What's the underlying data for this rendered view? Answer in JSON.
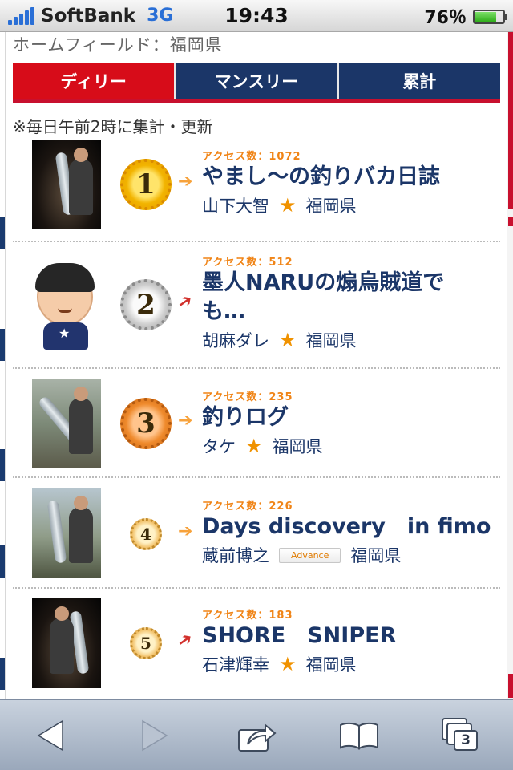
{
  "status_bar": {
    "carrier": "SoftBank",
    "network": "3G",
    "time": "19:43",
    "battery_text": "76％",
    "battery_level": 0.76
  },
  "page": {
    "home_field": "ホームフィールド：福岡県",
    "tabs": [
      {
        "label": "ディリー",
        "active": true
      },
      {
        "label": "マンスリー",
        "active": false
      },
      {
        "label": "累計",
        "active": false
      }
    ],
    "note": "※毎日午前2時に集計・更新"
  },
  "ranking": [
    {
      "rank": "1",
      "access": "アクセス数：1072",
      "title": "やまし〜の釣りバカ日誌",
      "owner": "山下大智",
      "mark": "★",
      "region": "福岡県",
      "trend": "right",
      "medal": "gold",
      "thumb": "night-fishing-photo"
    },
    {
      "rank": "2",
      "access": "アクセス数：512",
      "title": "墨人NARUの煽烏賊道でも…",
      "title_line1": "墨人NARUの煽烏賊道で",
      "title_line2": "も…",
      "owner": "胡麻ダレ",
      "mark": "★",
      "region": "福岡県",
      "trend": "up",
      "medal": "silver",
      "thumb": "avatar-illustration"
    },
    {
      "rank": "3",
      "access": "アクセス数：235",
      "title": "釣りログ",
      "owner": "タケ",
      "mark": "★",
      "region": "福岡県",
      "trend": "right",
      "medal": "bronze",
      "thumb": "beach-fishing-photo"
    },
    {
      "rank": "4",
      "access": "アクセス数：226",
      "title": "Days discovery　in fimo",
      "owner": "蔵前博之",
      "badge": "Advance",
      "region": "福岡県",
      "trend": "right",
      "medal": "small",
      "thumb": "dusk-fishing-photo"
    },
    {
      "rank": "5",
      "access": "アクセス数：183",
      "title": "SHORE　SNIPER",
      "owner": "石津輝幸",
      "mark": "★",
      "region": "福岡県",
      "trend": "up",
      "medal": "small",
      "thumb": "night-fishing-photo"
    }
  ],
  "toolbar": {
    "tab_count": "3",
    "icons": [
      "back-arrow-icon",
      "forward-arrow-icon",
      "share-icon",
      "bookmarks-icon",
      "tabs-icon"
    ]
  },
  "colors": {
    "tab_active": "#d70c19",
    "tab_inactive": "#1b3668",
    "title_text": "#1b3668",
    "access_text": "#f08416",
    "star": "#f09200"
  }
}
